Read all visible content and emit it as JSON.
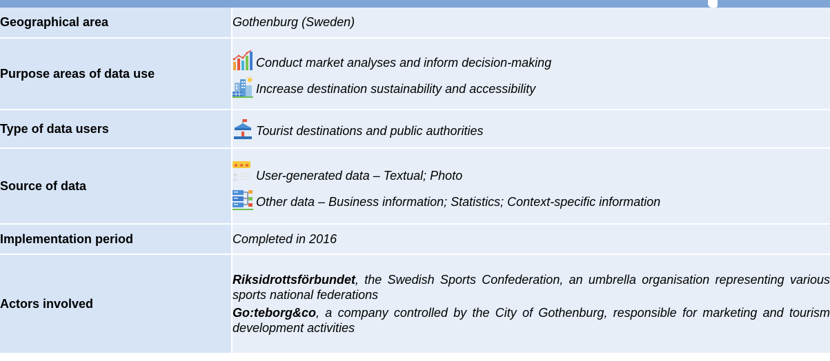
{
  "rows": {
    "geo": {
      "label": "Geographical area",
      "value": "Gothenburg (Sweden)"
    },
    "purpose": {
      "label": "Purpose areas of data use",
      "items": [
        {
          "icon": "bar-chart-icon",
          "text": "Conduct market analyses and inform decision-making"
        },
        {
          "icon": "sustainable-city-icon",
          "text": "Increase destination sustainability and accessibility"
        }
      ]
    },
    "users": {
      "label": "Type of data users",
      "items": [
        {
          "icon": "public-building-icon",
          "text": "Tourist destinations and public authorities"
        }
      ]
    },
    "source": {
      "label": "Source of data",
      "items": [
        {
          "icon": "user-review-icon",
          "text": "User-generated data – Textual; Photo"
        },
        {
          "icon": "database-network-icon",
          "text": "Other data – Business information; Statistics; Context-specific information"
        }
      ]
    },
    "period": {
      "label": "Implementation period",
      "value": "Completed in 2016"
    },
    "actors": {
      "label": "Actors involved",
      "items": [
        {
          "name": "Riksidrottsförbundet",
          "desc": ", the Swedish Sports Confederation, an umbrella organisation representing various sports national federations"
        },
        {
          "name": "Go:teborg&co",
          "desc": ", a company controlled by the City of Gothenburg, responsible for marketing and tourism development activities"
        }
      ]
    }
  },
  "colors": {
    "header_bar": "#7fa5d6",
    "label_bg": "#d6e4f6",
    "value_bg": "#e7eef8"
  }
}
